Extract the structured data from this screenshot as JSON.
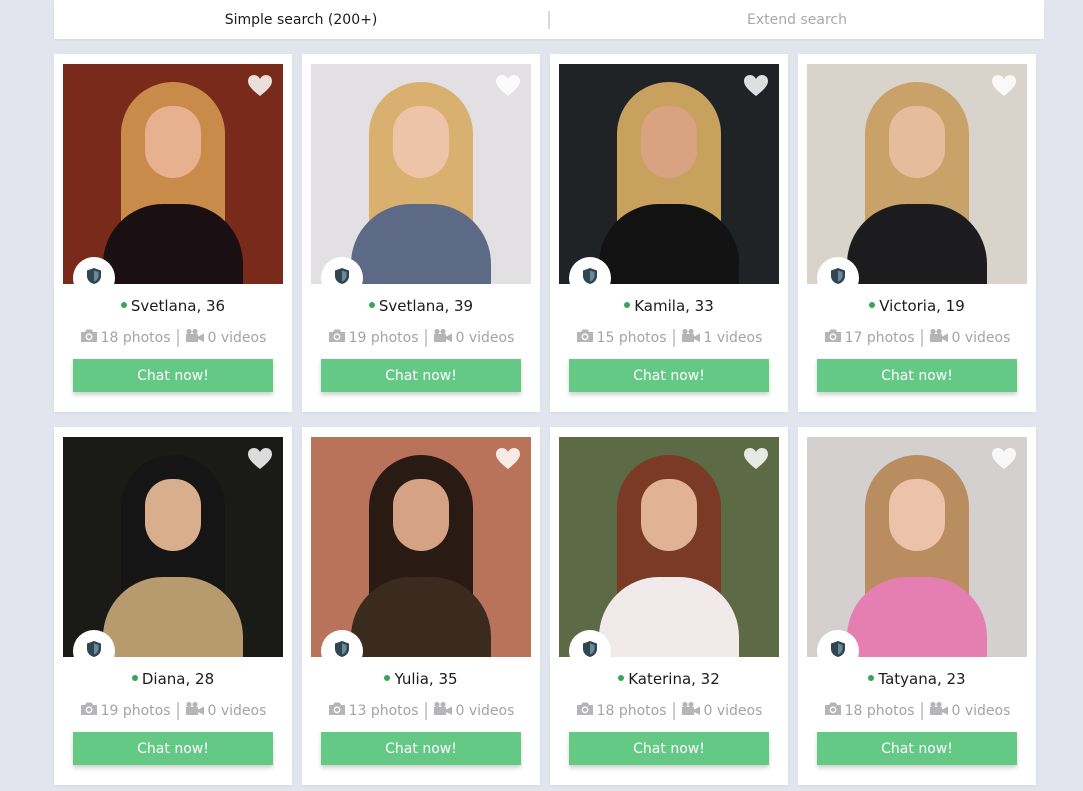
{
  "search": {
    "simple_label": "Simple search (200+)",
    "extend_label": "Extend search"
  },
  "colors": {
    "page_bg": "#e3e5ee",
    "chat_button": "#64c985",
    "online_dot": "#3aa35b",
    "muted_text": "#a3a3a8"
  },
  "icons": {
    "favorite": "heart-icon",
    "verified": "shield-icon",
    "photos": "camera-icon",
    "videos": "video-camera-icon"
  },
  "profiles": [
    {
      "name": "Svetlana, 36",
      "photos": "18 photos",
      "videos": "0 videos",
      "chat": "Chat now!",
      "online": true,
      "bg": "#7a2a1a",
      "hair": "#c98b4a",
      "skin": "#e7b08f",
      "body": "#1a0f12"
    },
    {
      "name": "Svetlana, 39",
      "photos": "19 photos",
      "videos": "0 videos",
      "chat": "Chat now!",
      "online": true,
      "bg": "#e2e0e2",
      "hair": "#d9b070",
      "skin": "#edc4a8",
      "body": "#5d6a86"
    },
    {
      "name": "Kamila, 33",
      "photos": "15 photos",
      "videos": "1 videos",
      "chat": "Chat now!",
      "online": true,
      "bg": "#1f2326",
      "hair": "#c9a15e",
      "skin": "#d9a382",
      "body": "#121212"
    },
    {
      "name": "Victoria, 19",
      "photos": "17 photos",
      "videos": "0 videos",
      "chat": "Chat now!",
      "online": true,
      "bg": "#d8d4cc",
      "hair": "#c9a26a",
      "skin": "#e6bd9c",
      "body": "#1c1c1f"
    },
    {
      "name": "Diana, 28",
      "photos": "19 photos",
      "videos": "0 videos",
      "chat": "Chat now!",
      "online": true,
      "bg": "#1a1a17",
      "hair": "#151515",
      "skin": "#d9ae8c",
      "body": "#b79a6d"
    },
    {
      "name": "Yulia, 35",
      "photos": "13 photos",
      "videos": "0 videos",
      "chat": "Chat now!",
      "online": true,
      "bg": "#b9735a",
      "hair": "#2a1a14",
      "skin": "#d6a285",
      "body": "#3b2a1e"
    },
    {
      "name": "Katerina, 32",
      "photos": "18 photos",
      "videos": "0 videos",
      "chat": "Chat now!",
      "online": true,
      "bg": "#5c6a45",
      "hair": "#7a3a25",
      "skin": "#e2b296",
      "body": "#f0eaea"
    },
    {
      "name": "Tatyana, 23",
      "photos": "18 photos",
      "videos": "0 videos",
      "chat": "Chat now!",
      "online": true,
      "bg": "#d5d0d0",
      "hair": "#b98d5f",
      "skin": "#ecc2a8",
      "body": "#e57fb2"
    }
  ]
}
